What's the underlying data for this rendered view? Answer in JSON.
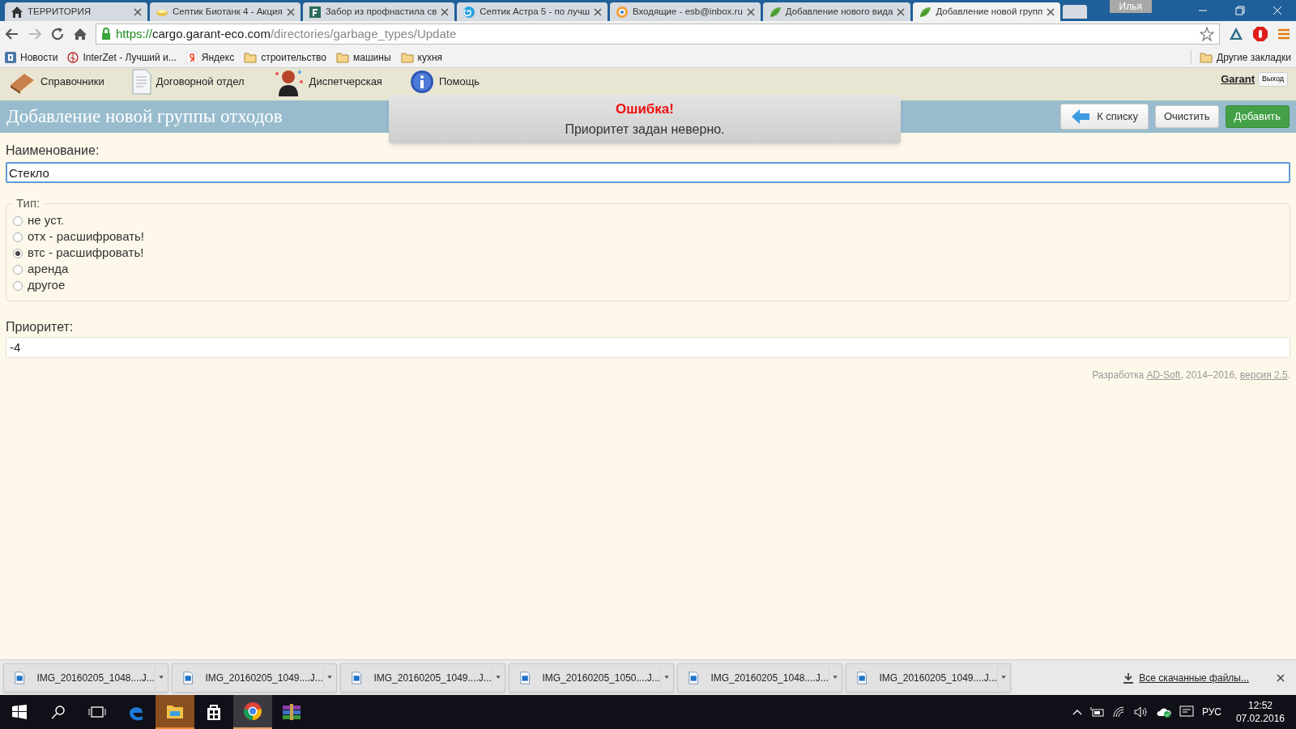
{
  "browser": {
    "tabs": [
      {
        "title": "ТЕРРИТОРИЯ",
        "selected": false
      },
      {
        "title": "Септик Биотанк 4 - Акция",
        "selected": false
      },
      {
        "title": "Забор из профнастила св",
        "selected": false
      },
      {
        "title": "Септик Астра 5 - по лучш",
        "selected": false
      },
      {
        "title": "Входящие - esb@inbox.ru",
        "selected": false
      },
      {
        "title": "Добавление нового вида",
        "selected": false
      },
      {
        "title": "Добавление новой групп",
        "selected": true
      }
    ],
    "profile": "Илья",
    "url": {
      "scheme": "https://",
      "host": "cargo.garant-eco.com",
      "path": "/directories/garbage_types/Update"
    },
    "bookmarks": [
      "Новости",
      "InterZet - Лучший и...",
      "Яндекс",
      "строительство",
      "машины",
      "кухня"
    ],
    "other_bookmarks": "Другие закладки"
  },
  "nav": {
    "items": [
      "Справочники",
      "Договорной отдел",
      "Диспетчерская",
      "Помощь"
    ],
    "user": "Garant",
    "logout": "Выход"
  },
  "page": {
    "title": "Добавление новой группы отходов",
    "buttons": [
      {
        "kind": "back",
        "label": "К списку"
      },
      {
        "kind": "plain",
        "label": "Очистить"
      },
      {
        "kind": "primary",
        "label": "Добавить"
      }
    ],
    "name_label": "Наименование:",
    "name_value": "Стекло",
    "type_legend": "Тип:",
    "types": [
      {
        "label": "не уст.",
        "selected": false
      },
      {
        "label": "отх - расшифровать!",
        "selected": false
      },
      {
        "label": "втс - расшифровать!",
        "selected": true
      },
      {
        "label": "аренда",
        "selected": false
      },
      {
        "label": "другое",
        "selected": false
      }
    ],
    "priority_label": "Приоритет:",
    "priority_value": "-4",
    "footer": {
      "prefix": "Разработка ",
      "link": "AD-Soft",
      "middle": ", 2014–2016, ",
      "version": "версия 2.5",
      "suffix": "."
    }
  },
  "toast": {
    "title": "Ошибка!",
    "message": "Приоритет задан неверно."
  },
  "downloads": {
    "files": [
      "IMG_20160205_1048....J...",
      "IMG_20160205_1049....J...",
      "IMG_20160205_1049....J...",
      "IMG_20160205_1050....J...",
      "IMG_20160205_1048....J...",
      "IMG_20160205_1049....J..."
    ],
    "all": "Все скачанные файлы..."
  },
  "taskbar": {
    "apps": [
      {
        "active": false
      },
      {
        "active": true
      },
      {
        "active": false
      },
      {
        "active": true
      },
      {
        "active": false
      }
    ],
    "language": "РУС",
    "time": "12:52",
    "date": "07.02.2016"
  }
}
